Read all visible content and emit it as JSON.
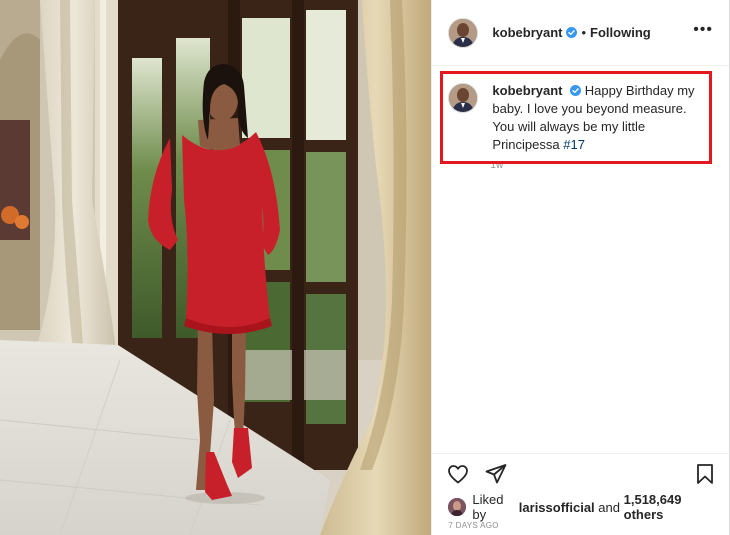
{
  "post": {
    "author": "kobebryant",
    "follow_state": "Following",
    "dot": "•",
    "more": "•••"
  },
  "caption": {
    "author": "kobebryant",
    "text": "Happy Birthday my baby. I love you beyond measure. You will always be my little Principessa",
    "hashtag": "#17",
    "time": "1w"
  },
  "likes": {
    "prefix": "Liked by",
    "liker": "larissofficial",
    "and": "and",
    "count": "1,518,649 others"
  },
  "post_age": "7 DAYS AGO",
  "icons": {
    "verified": "verified-badge",
    "like": "heart-outline",
    "share": "paper-plane",
    "save": "bookmark-outline",
    "more": "ellipsis-horizontal"
  },
  "colors": {
    "highlight": "#e3171f",
    "verified": "#3897f0",
    "hashtag": "#00376b",
    "muted": "#8e8e8e",
    "dress": "#c8202a"
  }
}
